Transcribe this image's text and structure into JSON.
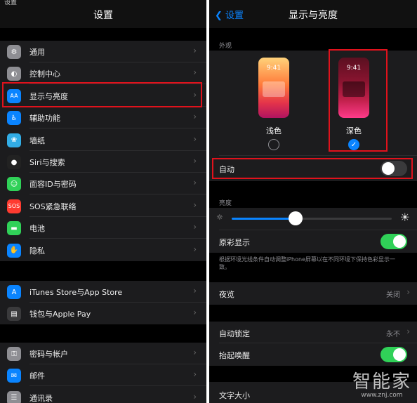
{
  "left": {
    "status_fragment": "设置",
    "title": "设置",
    "groups": [
      {
        "items": [
          {
            "label": "通用",
            "icon": "gear-icon",
            "color": "#8e8e93",
            "glyph": "⚙"
          },
          {
            "label": "控制中心",
            "icon": "toggles-icon",
            "color": "#8e8e93",
            "glyph": "◐"
          },
          {
            "label": "显示与亮度",
            "icon": "text-size-icon",
            "color": "#0a84ff",
            "glyph": "AA"
          },
          {
            "label": "辅助功能",
            "icon": "accessibility-icon",
            "color": "#0a84ff",
            "glyph": "♿"
          },
          {
            "label": "墙纸",
            "icon": "wallpaper-icon",
            "color": "#32ade6",
            "glyph": "❀"
          },
          {
            "label": "Siri与搜索",
            "icon": "siri-icon",
            "color": "#222",
            "glyph": "●"
          },
          {
            "label": "面容ID与密码",
            "icon": "face-id-icon",
            "color": "#30d158",
            "glyph": "☺"
          },
          {
            "label": "SOS紧急联络",
            "icon": "sos-icon",
            "color": "#ff3b30",
            "glyph": "SOS"
          },
          {
            "label": "电池",
            "icon": "battery-icon",
            "color": "#30d158",
            "glyph": "▬"
          },
          {
            "label": "隐私",
            "icon": "privacy-hand-icon",
            "color": "#0a84ff",
            "glyph": "✋"
          }
        ]
      },
      {
        "items": [
          {
            "label": "iTunes Store与App Store",
            "icon": "app-store-icon",
            "color": "#0a84ff",
            "glyph": "A"
          },
          {
            "label": "钱包与Apple Pay",
            "icon": "wallet-icon",
            "color": "#3a3a3c",
            "glyph": "▤"
          }
        ]
      },
      {
        "items": [
          {
            "label": "密码与帐户",
            "icon": "key-icon",
            "color": "#8e8e93",
            "glyph": "⚿"
          },
          {
            "label": "邮件",
            "icon": "mail-icon",
            "color": "#0a84ff",
            "glyph": "✉"
          },
          {
            "label": "通讯录",
            "icon": "contacts-icon",
            "color": "#8e8e93",
            "glyph": "☰"
          }
        ]
      }
    ]
  },
  "right": {
    "back_label": "设置",
    "title": "显示与亮度",
    "appearance_header": "外观",
    "light_label": "浅色",
    "dark_label": "深色",
    "phone_time": "9:41",
    "auto_label": "自动",
    "brightness_header": "亮度",
    "brightness_level": 0.4,
    "true_tone_label": "原彩显示",
    "true_tone_desc": "根据环境光线条件自动调整iPhone屏幕以在不同环境下保持色彩显示一致。",
    "night_shift_label": "夜览",
    "night_shift_value": "关闭",
    "auto_lock_label": "自动锁定",
    "auto_lock_value": "永不",
    "raise_to_wake_label": "抬起唤醒",
    "text_size_label": "文字大小"
  },
  "watermark": {
    "text": "智能家",
    "url": "www.znj.com"
  },
  "colors": {
    "accent": "#0a84ff",
    "highlight": "#e0121c",
    "toggle_on": "#30d158"
  }
}
